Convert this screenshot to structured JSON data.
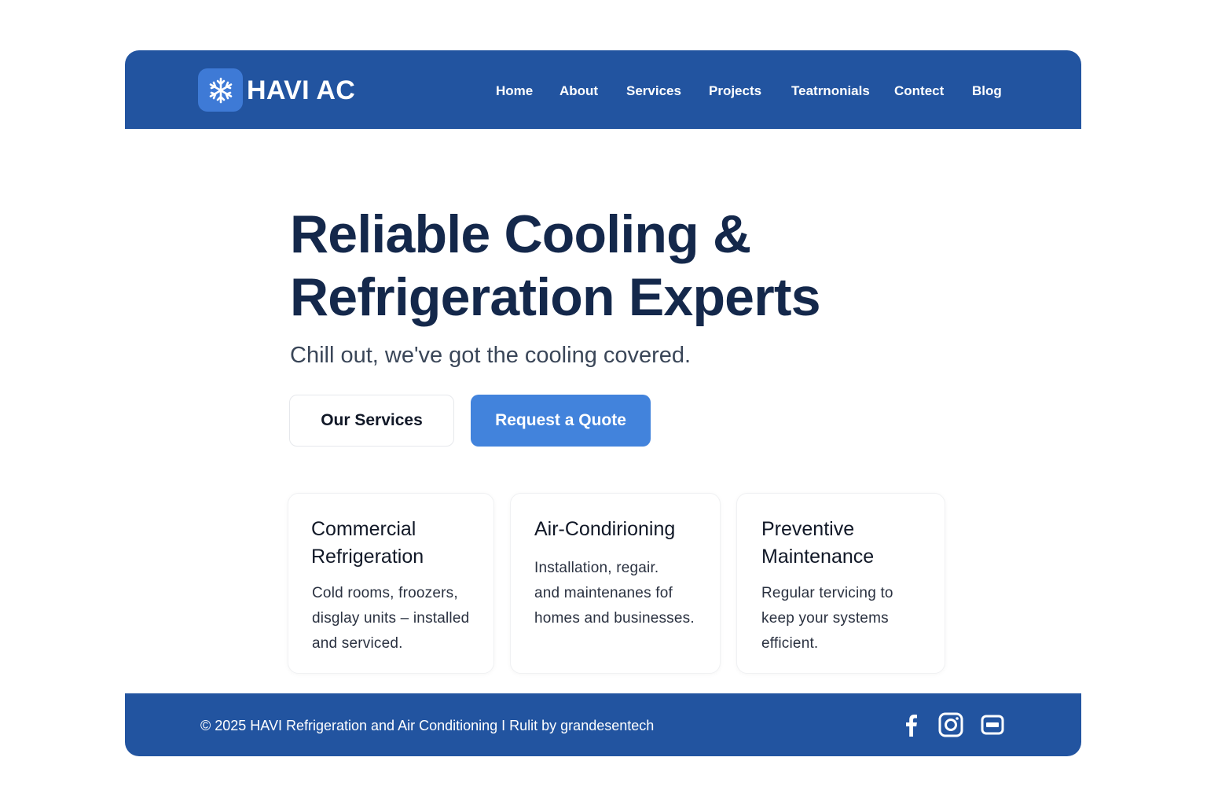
{
  "brand": {
    "name": "HAVI AC",
    "logo_icon": "snowflake-icon"
  },
  "nav": {
    "items": [
      "Home",
      "About",
      "Services",
      "Projects",
      "Teatrnonials",
      "Contect",
      "Blog"
    ]
  },
  "hero": {
    "title_line1": "Reliable Cooling &",
    "title_line2": "Refrigeration Experts",
    "subtitle": "Chill out, we've got the cooling covered.",
    "btn_services": "Our Services",
    "btn_quote": "Request a Quote"
  },
  "cards": [
    {
      "title_line1": "Commercial",
      "title_line2": "Refrigeration",
      "text": [
        "Cold rooms, froozers,",
        "disglay units – installed",
        "and serviced."
      ]
    },
    {
      "title_line1": "Air-Condirioning",
      "title_line2": "",
      "text": [
        "Installation, regair.",
        "and maintenanes fof",
        "homes and businesses."
      ]
    },
    {
      "title_line1": "Preventive",
      "title_line2": "Maintenance",
      "text": [
        "Regular tervicing to",
        "keep your systems",
        "efficient."
      ]
    }
  ],
  "footer": {
    "copyright": "© 2025 HAVI Refrigeration and Air Conditioning I Rulit by grandesentech",
    "social_icons": [
      "facebook-icon",
      "instagram-icon",
      "email-icon"
    ]
  },
  "colors": {
    "primary": "#2254a0",
    "accent": "#4283dc",
    "heading": "#14284b"
  }
}
